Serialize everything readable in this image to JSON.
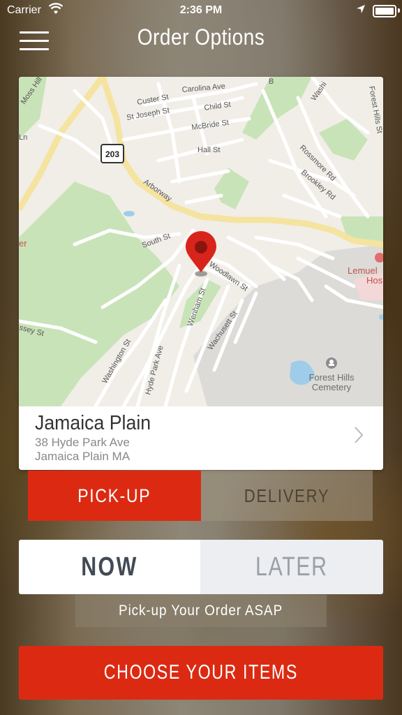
{
  "status_bar": {
    "carrier": "Carrier",
    "time": "2:36 PM"
  },
  "header": {
    "title": "Order Options",
    "menu_icon": "hamburger-menu-icon"
  },
  "map": {
    "labels": {
      "custer": "Custer St",
      "carolina": "Carolina Ave",
      "joseph": "St Joseph St",
      "child": "Child St",
      "mcbride": "McBride St",
      "hall": "Hall St",
      "route": "203",
      "arborway": "Arborway",
      "south": "South St",
      "woodlawn": "Woodlawn St",
      "wenham": "Wenham St",
      "wachusett": "Wachusett St",
      "washington": "Washington St",
      "hydepark": "Hyde Park Ave",
      "rossmore": "Rossmore Rd",
      "brookley": "Brookley Rd",
      "foresthills_st": "Forest Hills St",
      "moss": "Moss Hill",
      "lemuel": "Lemuel",
      "hosp": "Hos",
      "cemetery1": "Forest Hills",
      "cemetery2": "Cemetery",
      "washing_top": "Washi",
      "b_top": "B",
      "ln": "Ln",
      "ssey": "ssey St",
      "er": "er"
    },
    "pin_color": "#d9241b"
  },
  "location": {
    "name": "Jamaica Plain",
    "address_line1": "38 Hyde Park Ave",
    "address_line2": "Jamaica Plain MA"
  },
  "order_method": {
    "pickup": "PICK-UP",
    "delivery": "DELIVERY",
    "selected": "pickup"
  },
  "order_time": {
    "now": "NOW",
    "later": "LATER",
    "selected": "now"
  },
  "info": {
    "message": "Pick-up Your Order ASAP"
  },
  "cta": {
    "label": "CHOOSE YOUR ITEMS"
  },
  "colors": {
    "accent": "#dc2a12",
    "text_dark": "#424a55",
    "text_muted": "#9aa0a8"
  }
}
